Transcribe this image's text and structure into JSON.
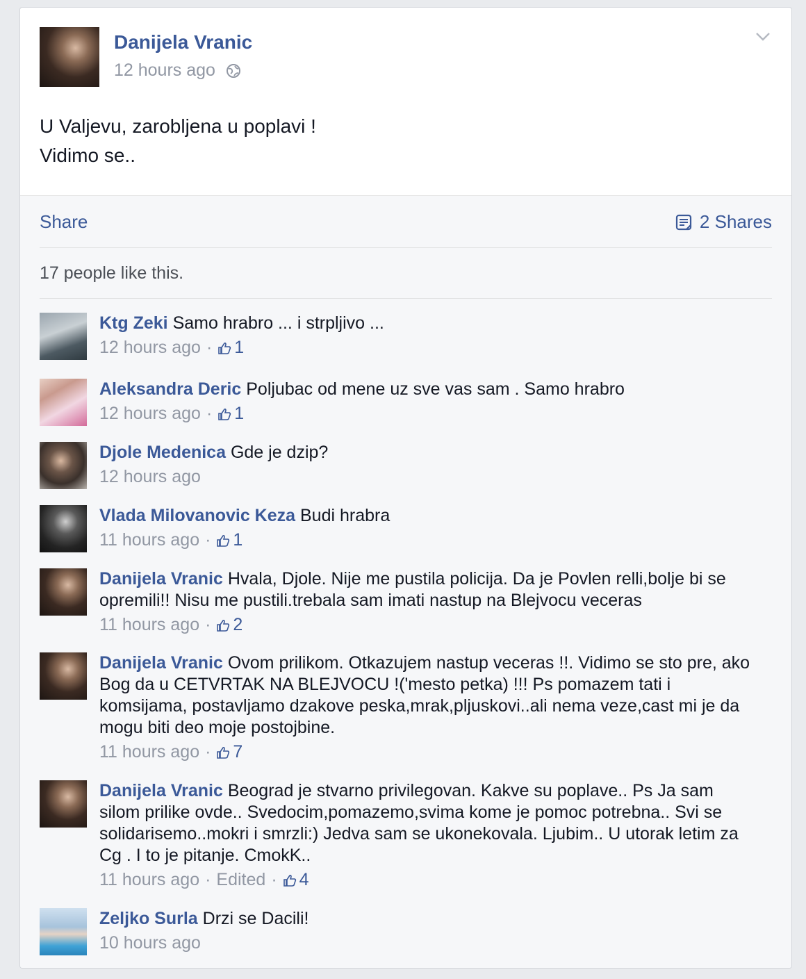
{
  "post": {
    "author": "Danijela Vranic",
    "time": "12 hours ago",
    "privacy_icon": "globe-icon",
    "menu_icon": "chevron-down-icon",
    "text_line1": "U Valjevu, zarobljena u poplavi !",
    "text_line2": "Vidimo se.."
  },
  "actions": {
    "share_label": "Share",
    "shares_count": "2 Shares"
  },
  "likes_summary": "17 people like this.",
  "comments": [
    {
      "name": "Ktg Zeki",
      "text": "Samo hrabro ... i strpljivo ...",
      "time": "12 hours ago",
      "likes": "1",
      "edited": ""
    },
    {
      "name": "Aleksandra Deric",
      "text": "Poljubac od mene uz sve vas sam . Samo hrabro",
      "time": "12 hours ago",
      "likes": "1",
      "edited": ""
    },
    {
      "name": "Djole Medenica",
      "text": "Gde je dzip?",
      "time": "12 hours ago",
      "likes": "",
      "edited": ""
    },
    {
      "name": "Vlada Milovanovic Keza",
      "text": "Budi hrabra",
      "time": "11 hours ago",
      "likes": "1",
      "edited": ""
    },
    {
      "name": "Danijela Vranic",
      "text": "Hvala, Djole. Nije me pustila policija. Da je Povlen relli,bolje bi se opremili!! Nisu me pustili.trebala sam imati nastup na Blejvocu veceras",
      "time": "11 hours ago",
      "likes": "2",
      "edited": ""
    },
    {
      "name": "Danijela Vranic",
      "text": "Ovom prilikom. Otkazujem nastup veceras !!. Vidimo se sto pre, ako Bog da u CETVRTAK NA BLEJVOCU !('mesto petka) !!! Ps pomazem tati i komsijama, postavljamo dzakove peska,mrak,pljuskovi..ali nema veze,cast mi je da mogu biti deo moje postojbine.",
      "time": "11 hours ago",
      "likes": "7",
      "edited": ""
    },
    {
      "name": "Danijela Vranic",
      "text": "Beograd je stvarno privilegovan. Kakve su poplave.. Ps Ja sam silom prilike ovde.. Svedocim,pomazemo,svima kome je pomoc potrebna.. Svi se solidarisemo..mokri i smrzli:) Jedva sam se ukonekovala. Ljubim.. U utorak letim za Cg . I to je pitanje. CmokK..",
      "time": "11 hours ago",
      "likes": "4",
      "edited": "Edited"
    },
    {
      "name": "Zeljko Surla",
      "text": "Drzi se Dacili!",
      "time": "10 hours ago",
      "likes": "",
      "edited": ""
    }
  ],
  "icons": {
    "like": "thumbs-up-icon",
    "shares": "shares-icon"
  },
  "colors": {
    "link": "#3b5998",
    "meta": "#9197a3",
    "feedback_bg": "#f6f7f9"
  }
}
